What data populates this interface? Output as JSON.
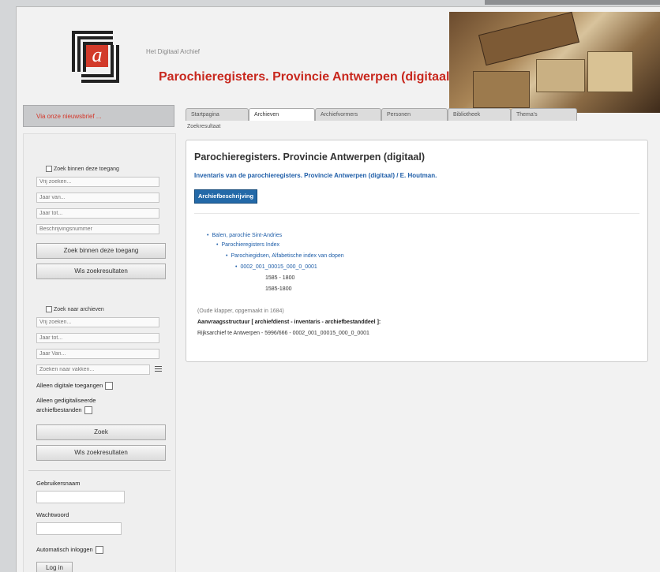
{
  "header": {
    "site_subtitle": "Het Digitaal Archief",
    "title": "Parochieregisters. Provincie Antwerpen (digitaal)"
  },
  "left_banner": "Via onze nieuwsbrief ...",
  "tabs": [
    {
      "label": "Startpagina",
      "active": false
    },
    {
      "label": "Archieven",
      "active": true
    },
    {
      "label": "Archiefvormers",
      "active": false
    },
    {
      "label": "Personen",
      "active": false
    },
    {
      "label": "Bibliotheek",
      "active": false
    },
    {
      "label": "Thema's",
      "active": false
    }
  ],
  "subtab": "Zoekresultaat",
  "sidebar": {
    "search_within_label": "Zoek binnen deze toegang",
    "within_fields": [
      {
        "placeholder": "Vrij zoeken..."
      },
      {
        "placeholder": "Jaar van..."
      },
      {
        "placeholder": "Jaar tot..."
      },
      {
        "placeholder": "Beschrijvingsnummer"
      }
    ],
    "search_within_button": "Zoek binnen deze toegang",
    "clear_button_1": "Wis zoekresultaten",
    "search_archives_label": "Zoek naar archieven",
    "archive_fields": [
      {
        "placeholder": "Vrij zoeken..."
      },
      {
        "placeholder": "Jaar tot..."
      },
      {
        "placeholder": "Jaar Van..."
      },
      {
        "placeholder": "Zoeken naar vakken..."
      }
    ],
    "only_digital_label": "Alleen digitale toegangen",
    "only_digitized_label": "Alleen gedigitaliseerde archiefbestanden",
    "search_button": "Zoek",
    "clear_button_2": "Wis zoekresultaten",
    "username_label": "Gebruikersnaam",
    "password_label": "Wachtwoord",
    "auto_login_label": "Automatisch inloggen",
    "login_button": "Log in"
  },
  "main": {
    "title": "Parochieregisters. Provincie Antwerpen (digitaal)",
    "inventory_link": "Inventaris van de parochieregisters. Provincie Antwerpen (digitaal) / E. Houtman.",
    "description_button": "Archiefbeschrijving",
    "tree": {
      "level1": "Balen, parochie Sint-Andries",
      "level2": "Parochieregisters Index",
      "level3": "Parochiegidsen, Alfabetische index van dopen",
      "level4": "0002_001_00015_000_0_0001",
      "date_range_1": "1585 - 1800",
      "date_range_2": "1585-1800",
      "note": "(Oude klapper, opgemaakt in 1684)",
      "call_number_label": "Aanvraagsstructuur [ archiefdienst - inventaris - archiefbestanddeel ]:",
      "call_number_value": "Rijksarchief te Antwerpen - 5996/666 - 0002_001_00015_000_0_0001"
    }
  }
}
